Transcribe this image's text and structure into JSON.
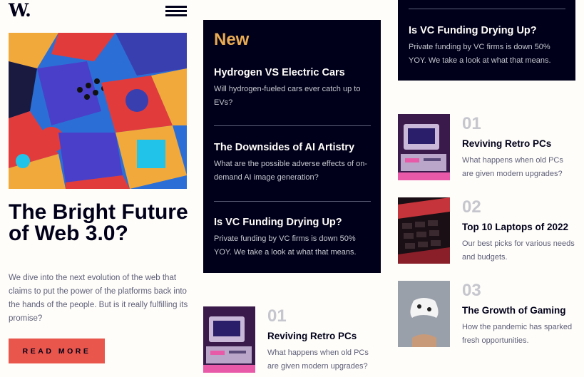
{
  "header": {
    "logo": "W."
  },
  "hero": {
    "headline": "The Bright Future of Web 3.0?",
    "lead": "We dive into the next evolution of the web that claims to put the power of the platforms back into the hands of the people. But is it really fulfilling its promise?",
    "cta_label": "READ MORE"
  },
  "new_section": {
    "title": "New",
    "items": [
      {
        "title": "Hydrogen VS Electric Cars",
        "description": "Will hydrogen-fueled cars ever catch up to EVs?"
      },
      {
        "title": "The Downsides of AI Artistry",
        "description": "What are the possible adverse effects of on-demand AI image generation?"
      },
      {
        "title": "Is VC Funding Drying Up?",
        "description": "Private funding by VC firms is down 50% YOY. We take a look at what that means."
      }
    ]
  },
  "vc_repeat": {
    "title": "Is VC Funding Drying Up?",
    "description": "Private funding by VC firms is down 50% YOY. We take a look at what that means."
  },
  "numbered": [
    {
      "number": "01",
      "title": "Reviving Retro PCs",
      "description": "What happens when old PCs are given modern upgrades?"
    },
    {
      "number": "02",
      "title": "Top 10 Laptops of 2022",
      "description": "Our best picks for various needs and budgets."
    },
    {
      "number": "03",
      "title": "The Growth of Gaming",
      "description": "How the pandemic has sparked fresh opportunities."
    }
  ],
  "numbered_repeat": {
    "number": "01",
    "title": "Reviving Retro PCs",
    "description": "What happens when old PCs are given modern upgrades?"
  },
  "colors": {
    "accent_red": "#e9564b",
    "accent_orange": "#e9ab53",
    "navy": "#00001a",
    "off_white": "#fffdf9",
    "grey": "#5d5f79"
  },
  "icons": [
    "menu-icon"
  ]
}
